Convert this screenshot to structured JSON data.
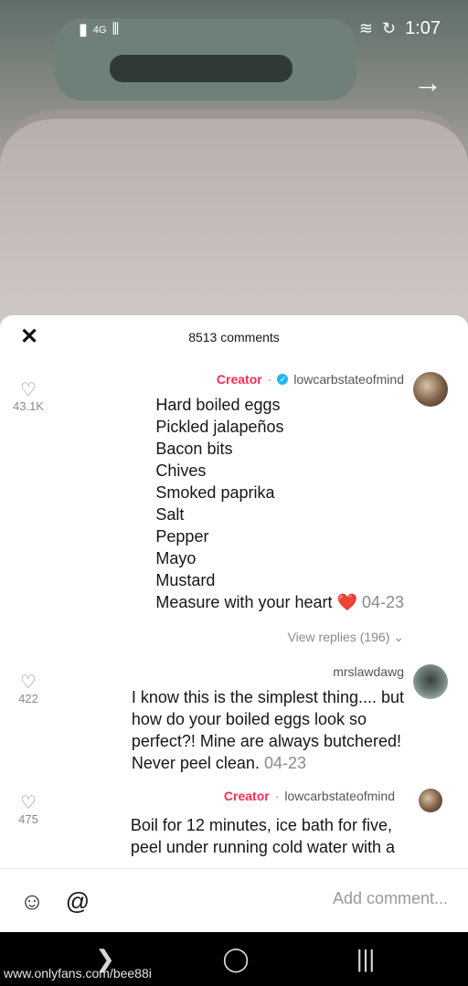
{
  "status_bar": {
    "time": "1:07",
    "icons": [
      "wifi-icon",
      "sync-icon",
      "battery-icon",
      "signal-icon",
      "network-badge-icon"
    ],
    "network_label": "4G"
  },
  "top_button": {
    "icon": "arrow-right-icon",
    "glyph": "→"
  },
  "panel": {
    "comment_count": "8513 comments",
    "close_glyph": "✕"
  },
  "comments": [
    {
      "username": "lowcarbstateofmind",
      "verified": true,
      "creator_label": "Creator",
      "separator": "·",
      "lines": [
        "Hard boiled eggs",
        "Pickled jalapeños",
        "Bacon bits",
        "Chives",
        "Smoked paprika",
        "Salt",
        "Pepper",
        "Mayo",
        "Mustard"
      ],
      "last_line_text": "Measure with your heart",
      "emoji": "❤️",
      "date": "04-23",
      "likes": "43.1K",
      "view_replies": "View replies (196)"
    },
    {
      "username": "mrslawdawg",
      "lines": [
        "I know this is the simplest thing.... but",
        "how do your boiled eggs look so",
        "perfect?! Mine are always butchered!"
      ],
      "last_line_text": "Never peel clean.",
      "date": "04-23",
      "likes": "422"
    },
    {
      "username": "lowcarbstateofmind",
      "creator_label": "Creator",
      "separator": "·",
      "lines": [
        "Boil for 12 minutes, ice bath for five,",
        "peel under running cold water with a"
      ],
      "likes": "475"
    }
  ],
  "input": {
    "placeholder": "Add comment...",
    "at_glyph": "@",
    "emoji_glyph": "☺"
  },
  "nav": {
    "recent_glyph": "|||",
    "home_glyph": "◯",
    "back_glyph": "❯"
  },
  "watermark": "www.onlyfans.com/bee88i"
}
